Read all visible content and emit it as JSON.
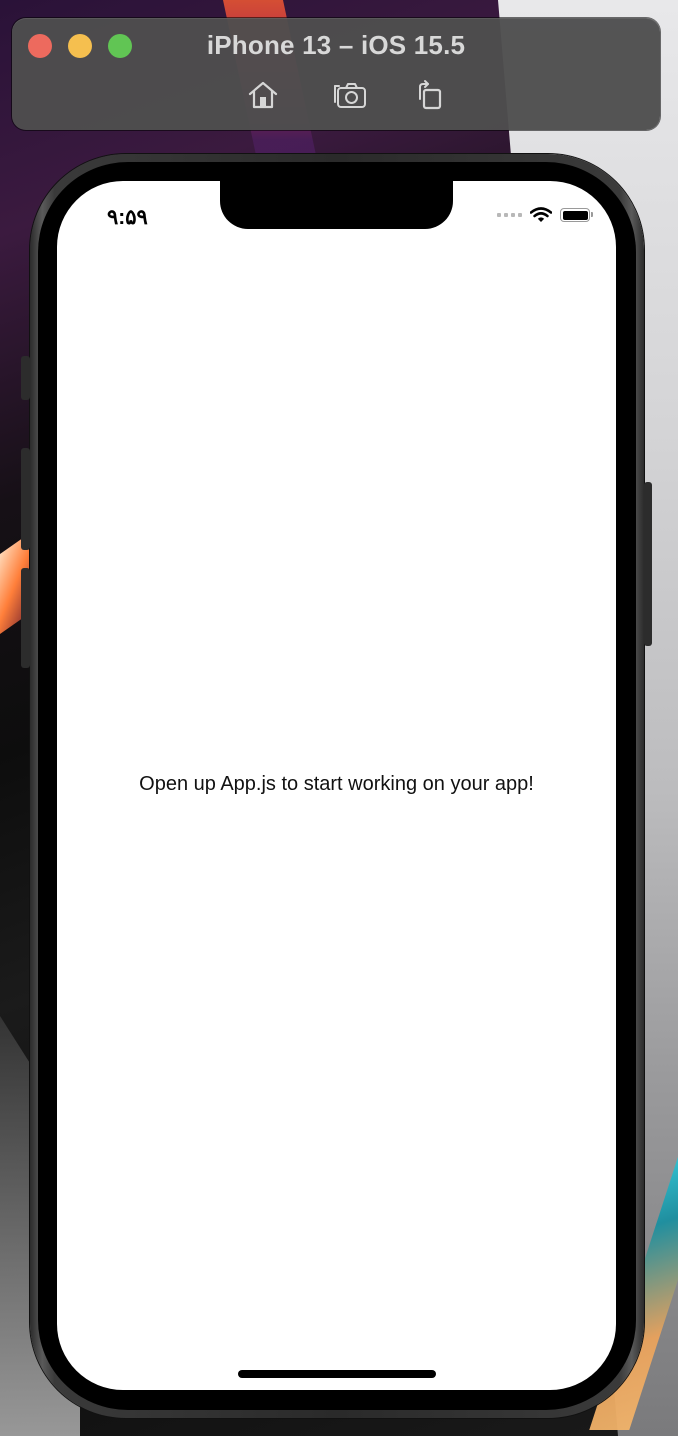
{
  "window": {
    "title": "iPhone 13 – iOS 15.5",
    "toolbar": {
      "home_icon": "home-icon",
      "screenshot_icon": "camera-icon",
      "rotate_icon": "rotate-icon"
    },
    "traffic_lights": {
      "close_color": "#ed6a5e",
      "minimize_color": "#f5bf4f",
      "zoom_color": "#61c554"
    }
  },
  "status_bar": {
    "time": "۹:۵۹",
    "icons": [
      "signal-dots-icon",
      "wifi-icon",
      "battery-icon"
    ]
  },
  "app": {
    "message": "Open up App.js to start working on your app!"
  }
}
